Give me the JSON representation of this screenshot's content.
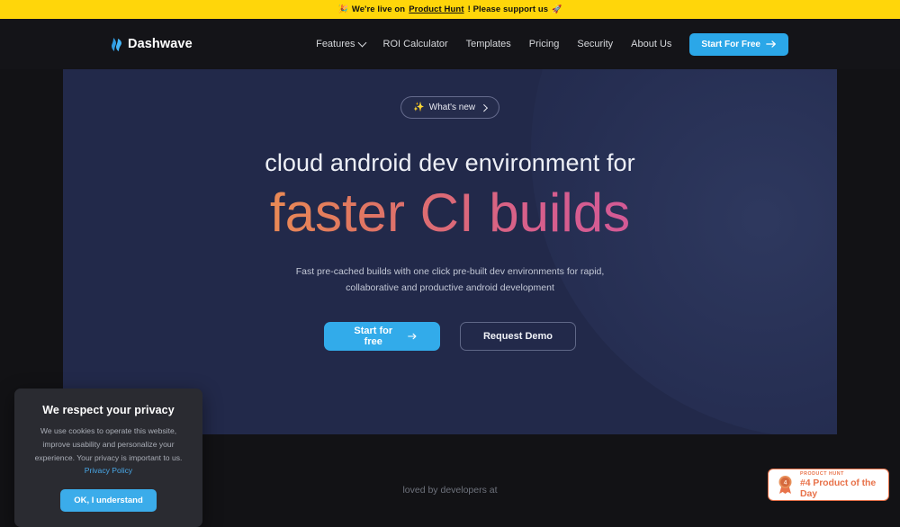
{
  "banner": {
    "emoji_left": "🎉",
    "text_before": "We're live on",
    "link_label": "Product Hunt",
    "text_after": "! Please support us",
    "emoji_right": "🚀",
    "bg_color": "#FFD60A"
  },
  "nav": {
    "logo_text": "Dashwave",
    "logo_icon": "wave-logo-icon",
    "links": [
      {
        "label": "Features",
        "has_chevron": true
      },
      {
        "label": "ROI Calculator",
        "has_chevron": false
      },
      {
        "label": "Templates",
        "has_chevron": false
      },
      {
        "label": "Pricing",
        "has_chevron": false
      },
      {
        "label": "Security",
        "has_chevron": false
      },
      {
        "label": "About Us",
        "has_chevron": false
      }
    ],
    "cta_label": "Start For Free",
    "cta_icon": "arrow-right-icon",
    "cta_color": "#2BA7E8"
  },
  "hero": {
    "pill": {
      "emoji": "✨",
      "label": "What's new",
      "chevron": "chevron-right-icon"
    },
    "headline_line1": "cloud android dev environment for",
    "headline_line2": "faster CI builds",
    "headline_gradient_from": "#EA8A55",
    "headline_gradient_to": "#D35A96",
    "subhead": "Fast pre-cached builds with one click pre-built dev environments for rapid, collaborative and productive android development",
    "primary_cta": "Start for free",
    "primary_cta_icon": "arrow-right-icon",
    "secondary_cta": "Request Demo"
  },
  "social_proof": {
    "label": "loved by developers at"
  },
  "cookie_consent": {
    "title": "We respect your privacy",
    "body_before": "We use cookies to operate this website, improve usability and personalize your experience. Your privacy is important to us.",
    "policy_link": "Privacy Policy",
    "accept_label": "OK, I understand",
    "accept_color": "#3BACEA"
  },
  "product_hunt_badge": {
    "kicker": "PRODUCT HUNT",
    "title": "#4 Product of the Day",
    "rank": "4",
    "accent_color": "#E8724A"
  }
}
